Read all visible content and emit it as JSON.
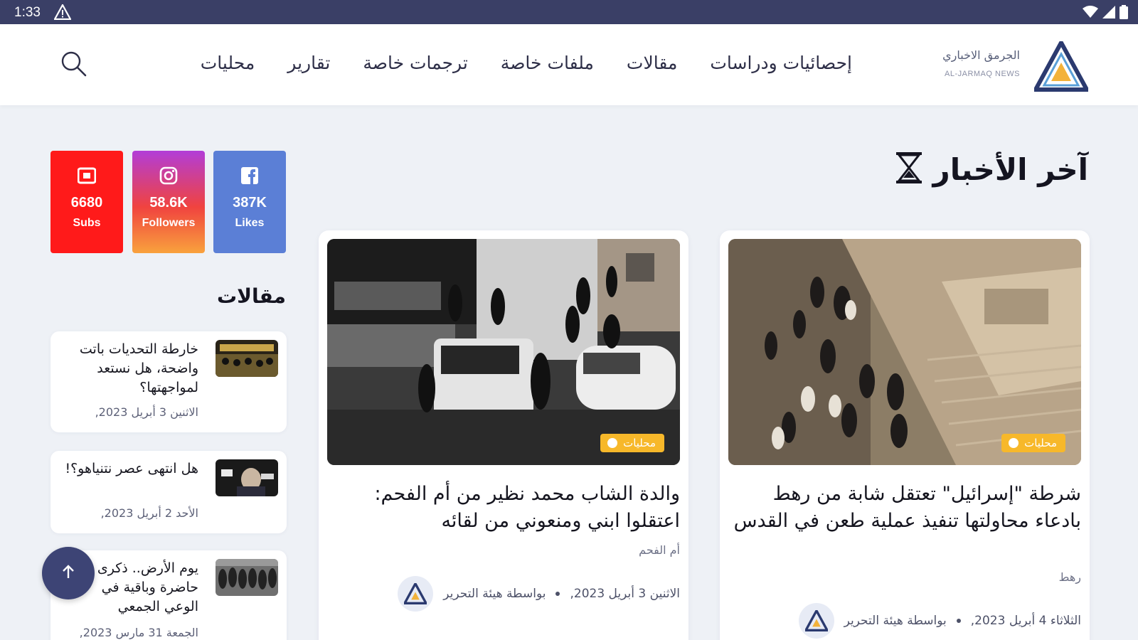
{
  "status_bar": {
    "time": "1:33",
    "icons": [
      "warning-icon",
      "wifi-icon",
      "signal-icon",
      "battery-icon"
    ]
  },
  "brand": {
    "name_ar": "الجرمق الاخباري",
    "name_en": "AL-JARMAQ NEWS"
  },
  "nav": {
    "items": [
      "محليات",
      "تقارير",
      "ترجمات خاصة",
      "ملفات خاصة",
      "مقالات",
      "إحصائيات ودراسات"
    ],
    "search_icon": "search-icon"
  },
  "latest": {
    "title": "آخر الأخبار",
    "icon": "hourglass-icon",
    "articles": [
      {
        "category": "محليات",
        "title": "شرطة \"إسرائيل\" تعتقل شابة من رهط بادعاء محاولتها تنفيذ عملية طعن في القدس",
        "location": "رهط",
        "author": "بواسطة هيئة التحرير",
        "date": "الثلاثاء 4 أبريل 2023,"
      },
      {
        "category": "محليات",
        "title": "والدة الشاب محمد نظير من أم الفحم: اعتقلوا ابني ومنعوني من لقائه",
        "location": "أم الفحم",
        "author": "بواسطة هيئة التحرير",
        "date": "الاثنين 3 أبريل 2023,"
      }
    ]
  },
  "social": {
    "youtube": {
      "count": "6680",
      "label": "Subs"
    },
    "instagram": {
      "count": "58.6K",
      "label": "Followers"
    },
    "facebook": {
      "count": "387K",
      "label": "Likes"
    }
  },
  "sidebar": {
    "title": "مقالات",
    "items": [
      {
        "title": "خارطة التحديات باتت واضحة، هل نستعد لمواجهتها؟",
        "date": "الاثنين 3 أبريل 2023,"
      },
      {
        "title": "هل انتهى عصر نتنياهو؟!",
        "date": "الأحد 2 أبريل 2023,"
      },
      {
        "title": "يوم الأرض.. ذكرى حاضرة وباقية في الوعي الجمعي",
        "date": "الجمعة 31 مارس 2023,"
      }
    ]
  },
  "colors": {
    "accent": "#3a3f66",
    "badge": "#f7b82a",
    "youtube": "#ff1a1a",
    "facebook": "#5b7fd6"
  }
}
